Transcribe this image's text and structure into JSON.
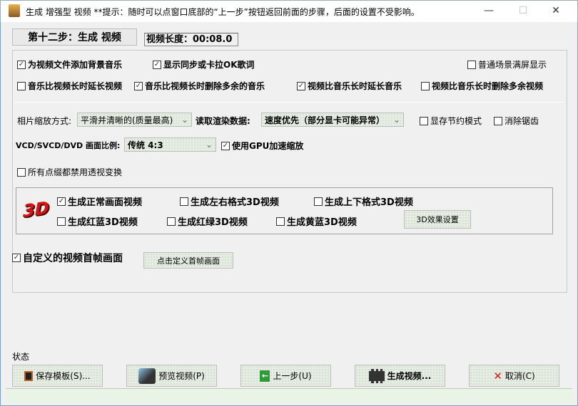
{
  "window": {
    "title": "生成 增强型 视频  **提示：随时可以点窗口底部的“上一步”按钮返回前面的步骤，后面的设置不受影响。",
    "minimize": "—",
    "maximize": "☐",
    "close": "✕"
  },
  "header": {
    "step_label": "第十二步：生成 视频",
    "duration": "视频长度：00:08.0"
  },
  "options": {
    "add_bg_music": {
      "label": "为视频文件添加背景音乐",
      "checked": true
    },
    "show_lyrics": {
      "label": "显示同步或卡拉OK歌词",
      "checked": true
    },
    "fullscreen": {
      "label": "普通场景满屏显示",
      "checked": false
    },
    "extend_video": {
      "label": "音乐比视频长时延长视频",
      "checked": false
    },
    "trim_music": {
      "label": "音乐比视频长时删除多余的音乐",
      "checked": true
    },
    "extend_music": {
      "label": "视频比音乐长时延长音乐",
      "checked": true
    },
    "trim_video": {
      "label": "视频比音乐长时删除多余视频",
      "checked": false
    }
  },
  "render": {
    "scale_label": "相片缩放方式:",
    "scale_value": "平滑并清晰的(质量最高)",
    "read_label": "读取渲染数据:",
    "read_value": "速度优先（部分显卡可能异常）",
    "memory_save": {
      "label": "显存节约模式",
      "checked": false
    },
    "antialias": {
      "label": "消除锯齿",
      "checked": false
    },
    "aspect_label": "VCD/SVCD/DVD 画面比例:",
    "aspect_value": "传统 4:3",
    "gpu": {
      "label": "使用GPU加速缩放",
      "checked": true
    },
    "no_perspective": {
      "label": "所有点缀都禁用透视变换",
      "checked": false
    }
  },
  "three_d": {
    "logo": "3D",
    "normal": {
      "label": "生成正常画面视频",
      "checked": true
    },
    "side_by_side": {
      "label": "生成左右格式3D视频",
      "checked": false
    },
    "top_bottom": {
      "label": "生成上下格式3D视频",
      "checked": false
    },
    "red_blue": {
      "label": "生成红蓝3D视频",
      "checked": false
    },
    "red_green": {
      "label": "生成红绿3D视频",
      "checked": false
    },
    "yellow_blue": {
      "label": "生成黄蓝3D视频",
      "checked": false
    },
    "settings_button": "3D效果设置"
  },
  "first_frame": {
    "label": "自定义的视频首帧画面",
    "checked": true,
    "button": "点击定义首帧画面"
  },
  "status_label": "状态",
  "buttons": {
    "save": "保存模板(S)...",
    "preview": "预览视频(P)",
    "back": "上一步(U)",
    "generate": "生成视频...",
    "cancel": "取消(C)"
  },
  "colors": {
    "status_bar": "#e9f3e6",
    "button_bg": "#e6ede2",
    "logo_red": "#d01818"
  }
}
